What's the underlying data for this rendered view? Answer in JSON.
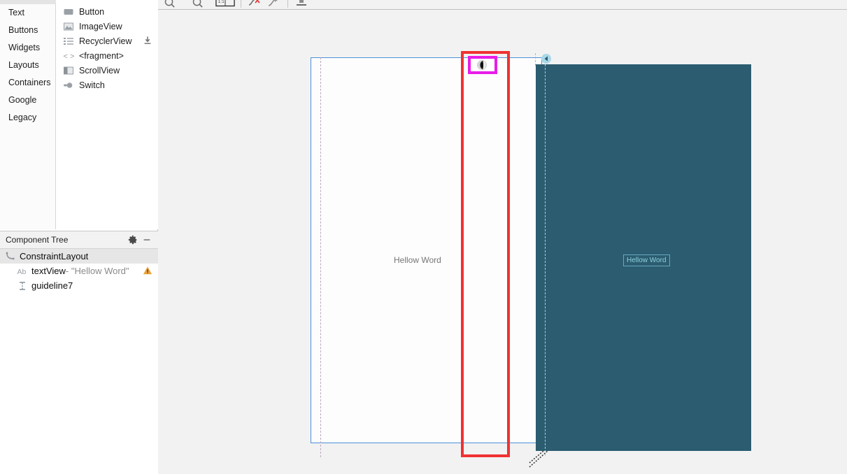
{
  "palette": {
    "categories": [
      {
        "label": "Text",
        "selected": false
      },
      {
        "label": "Buttons",
        "selected": false
      },
      {
        "label": "Widgets",
        "selected": false
      },
      {
        "label": "Layouts",
        "selected": false
      },
      {
        "label": "Containers",
        "selected": false
      },
      {
        "label": "Google",
        "selected": false
      },
      {
        "label": "Legacy",
        "selected": false
      }
    ],
    "items": [
      {
        "label": "Button",
        "icon": "button-icon",
        "download": false
      },
      {
        "label": "ImageView",
        "icon": "imageview-icon",
        "download": false
      },
      {
        "label": "RecyclerView",
        "icon": "recyclerview-icon",
        "download": true
      },
      {
        "label": "<fragment>",
        "icon": "fragment-icon",
        "download": false
      },
      {
        "label": "ScrollView",
        "icon": "scrollview-icon",
        "download": false
      },
      {
        "label": "Switch",
        "icon": "switch-icon",
        "download": false
      }
    ]
  },
  "component_tree": {
    "title": "Component Tree",
    "gear_icon": "gear-icon",
    "minimize_icon": "minimize-icon",
    "rows": [
      {
        "icon": "constraintlayout-icon",
        "label": "ConstraintLayout",
        "detail": "",
        "selected": true,
        "indent": 1,
        "warning": false
      },
      {
        "icon": "textview-ab-icon",
        "label": "textView",
        "detail": "- \"Hellow Word\"",
        "selected": false,
        "indent": 2,
        "warning": true
      },
      {
        "icon": "guideline-icon",
        "label": "guideline7",
        "detail": "",
        "selected": false,
        "indent": 2,
        "warning": false
      }
    ]
  },
  "toolbar": {
    "items": [
      {
        "name": "zoom-out-icon",
        "glyph": "○"
      },
      {
        "name": "zoom-in-icon",
        "glyph": "○"
      },
      {
        "name": "device-size-icon",
        "glyph": "▭"
      },
      {
        "name": "clear-constraints-icon",
        "glyph": "✘"
      },
      {
        "name": "infer-constraints-icon",
        "glyph": "↗"
      },
      {
        "name": "align-icon",
        "glyph": "⊥"
      }
    ]
  },
  "canvas": {
    "design_view": {
      "name": "design-surface",
      "text": "Hellow Word",
      "guideline_name": "vertical-guideline"
    },
    "blueprint_view": {
      "name": "blueprint-surface",
      "text": "Hellow Word",
      "guideline_name": "vertical-guideline",
      "handle_name": "guideline-toggle-handle",
      "resize_name": "resize-handle"
    },
    "selection_highlight": {
      "name": "red-annotation-box",
      "color": "#f03232"
    },
    "handle_highlight": {
      "name": "magenta-annotation-box",
      "color": "#e81de8",
      "handle_name": "guideline-toggle-handle"
    }
  },
  "colors": {
    "blueprint_bg": "#2b5c70",
    "design_bg": "#fdfdfd",
    "design_border": "#4a90d9",
    "red_highlight": "#f03232",
    "magenta_highlight": "#e81de8",
    "panel_bg": "#ffffff",
    "canvas_bg": "#f2f2f2",
    "warning": "#e8a33d"
  }
}
